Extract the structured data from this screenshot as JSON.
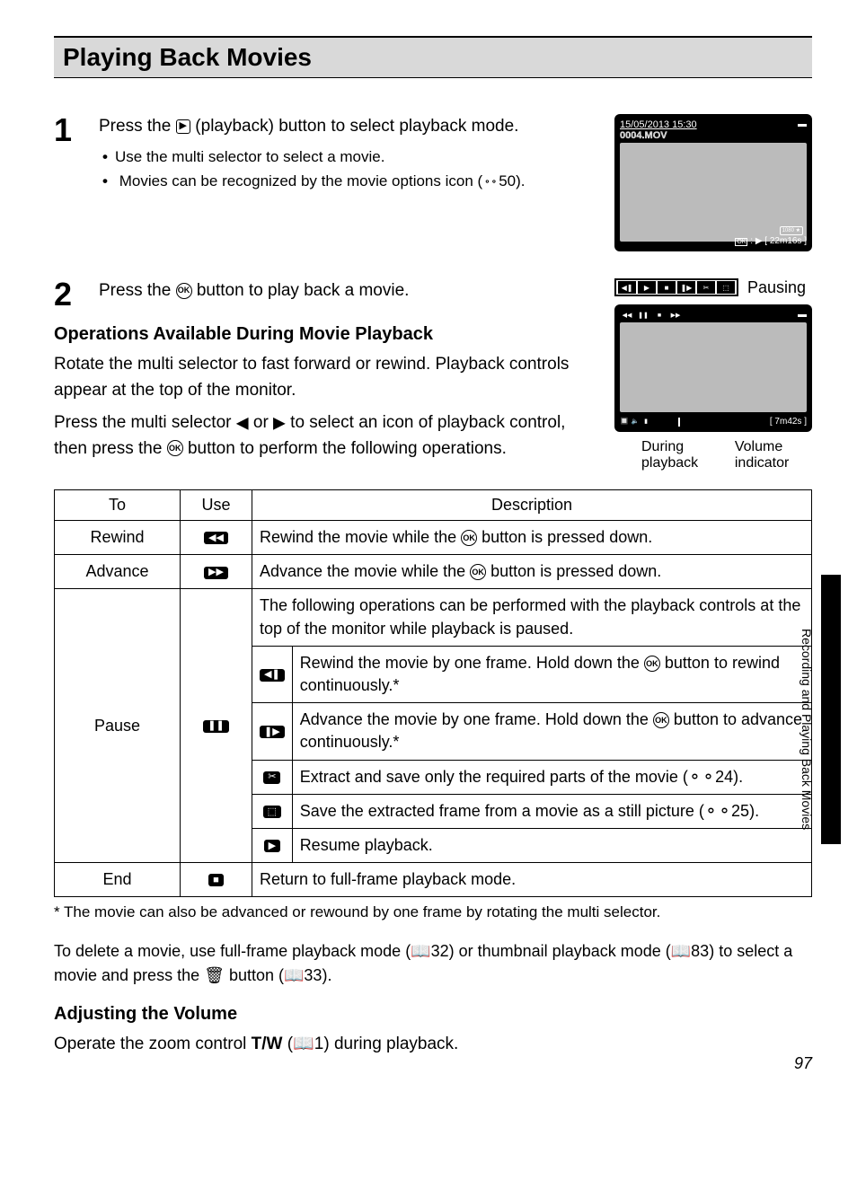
{
  "heading": "Playing Back Movies",
  "steps": {
    "s1": {
      "num": "1",
      "text_a": "Press the ",
      "text_b": " (playback) button to select playback mode.",
      "bullet1": "Use the multi selector to select a movie.",
      "bullet2_a": "Movies can be recognized by the movie options icon (",
      "bullet2_b": "50)."
    },
    "s2": {
      "num": "2",
      "text_a": "Press the ",
      "text_b": " button to play back a movie."
    }
  },
  "screen1": {
    "date": "15/05/2013 15:30",
    "file": "0004.MOV",
    "ok_label": "OK",
    "duration": "22m16s",
    "hd": "1080 ★"
  },
  "sub_heading": "Operations Available During Movie Playback",
  "para1": "Rotate the multi selector to fast forward or rewind. Playback controls appear at the top of the monitor.",
  "para2_a": "Press the multi selector ",
  "para2_b": " or ",
  "para2_c": " to select an icon of playback control, then press the ",
  "para2_d": " button to perform the following operations.",
  "callouts": {
    "pausing": "Pausing",
    "during": "During playback",
    "volume": "Volume indicator"
  },
  "screen2": {
    "duration": "7m42s"
  },
  "table": {
    "h1": "To",
    "h2": "Use",
    "h3": "Description",
    "rewind": {
      "to": "Rewind",
      "desc_a": "Rewind the movie while the ",
      "desc_b": " button is pressed down."
    },
    "advance": {
      "to": "Advance",
      "desc_a": "Advance the movie while the ",
      "desc_b": " button is pressed down."
    },
    "pause": {
      "to": "Pause",
      "intro": "The following operations can be performed with the playback controls at the top of the monitor while playback is paused.",
      "r1_a": "Rewind the movie by one frame. Hold down the ",
      "r1_b": " button to rewind continuously.*",
      "r2_a": "Advance the movie by one frame. Hold down the ",
      "r2_b": " button to advance continuously.*",
      "r3_a": "Extract and save only the required parts of the movie (",
      "r3_b": "24).",
      "r4_a": "Save the extracted frame from a movie as a still picture (",
      "r4_b": "25).",
      "r5": "Resume playback."
    },
    "end": {
      "to": "End",
      "desc": "Return to full-frame playback mode."
    }
  },
  "footnote": "*  The movie can also be advanced or rewound by one frame by rotating the multi selector.",
  "delete_a": "To delete a movie, use full-frame playback mode (",
  "delete_b": "32) or thumbnail playback mode (",
  "delete_c": "83) to select a movie and press the ",
  "delete_d": " button (",
  "delete_e": "33).",
  "volume_heading": "Adjusting the Volume",
  "volume_text_a": "Operate the zoom control ",
  "volume_text_b": " (",
  "volume_text_c": "1) during playback.",
  "volume_tw": "T/W",
  "side_text": "Recording and Playing Back Movies",
  "page_num": "97",
  "icons": {
    "play": "▶",
    "ok": "OK",
    "ref": "🔗",
    "left": "◀",
    "right": "▶",
    "rewind": "◀◀",
    "fastfwd": "▶▶",
    "pause": "❚❚",
    "frameback": "◀❚",
    "framefwd": "❚▶",
    "scissors": "✂",
    "saveframe": "⬚",
    "stop": "■",
    "book": "📖",
    "trash": "🗑",
    "cross_ref": "⚬⚬"
  }
}
